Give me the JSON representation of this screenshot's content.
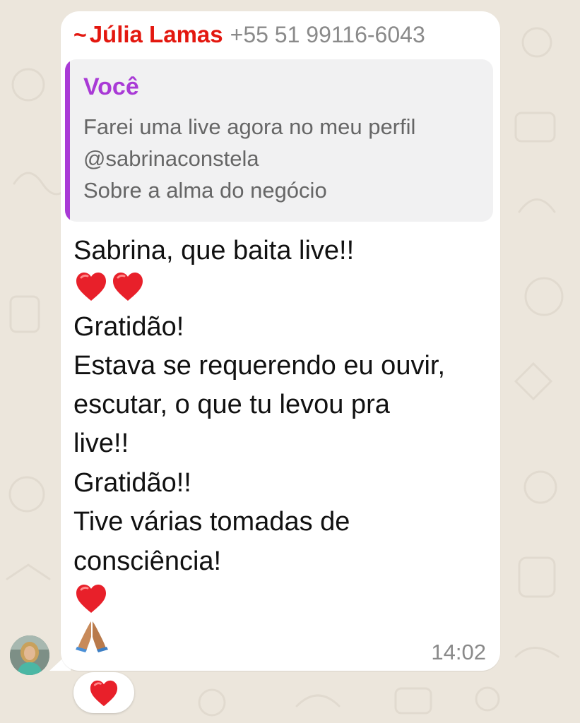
{
  "sender": {
    "tilde": "~",
    "name": "Júlia Lamas",
    "phone": "+55 51 99116-6043"
  },
  "quoted_message": {
    "author": "Você",
    "lines": [
      "Farei uma live agora no meu perfil",
      "@sabrinaconstela",
      "Sobre a alma do negócio"
    ]
  },
  "message": {
    "lines": [
      "Sabrina, que baita live!!",
      "Gratidão!",
      "Estava se requerendo eu ouvir,",
      "escutar, o que tu levou pra",
      "live!!",
      "Gratidão!!",
      "Tive várias tomadas de",
      "consciência!"
    ],
    "time": "14:02"
  },
  "reaction": {
    "emoji": "heart"
  },
  "colors": {
    "sender_name": "#e3170f",
    "quote_accent": "#a93ad6",
    "background": "#ece6dc",
    "bubble": "#ffffff"
  }
}
